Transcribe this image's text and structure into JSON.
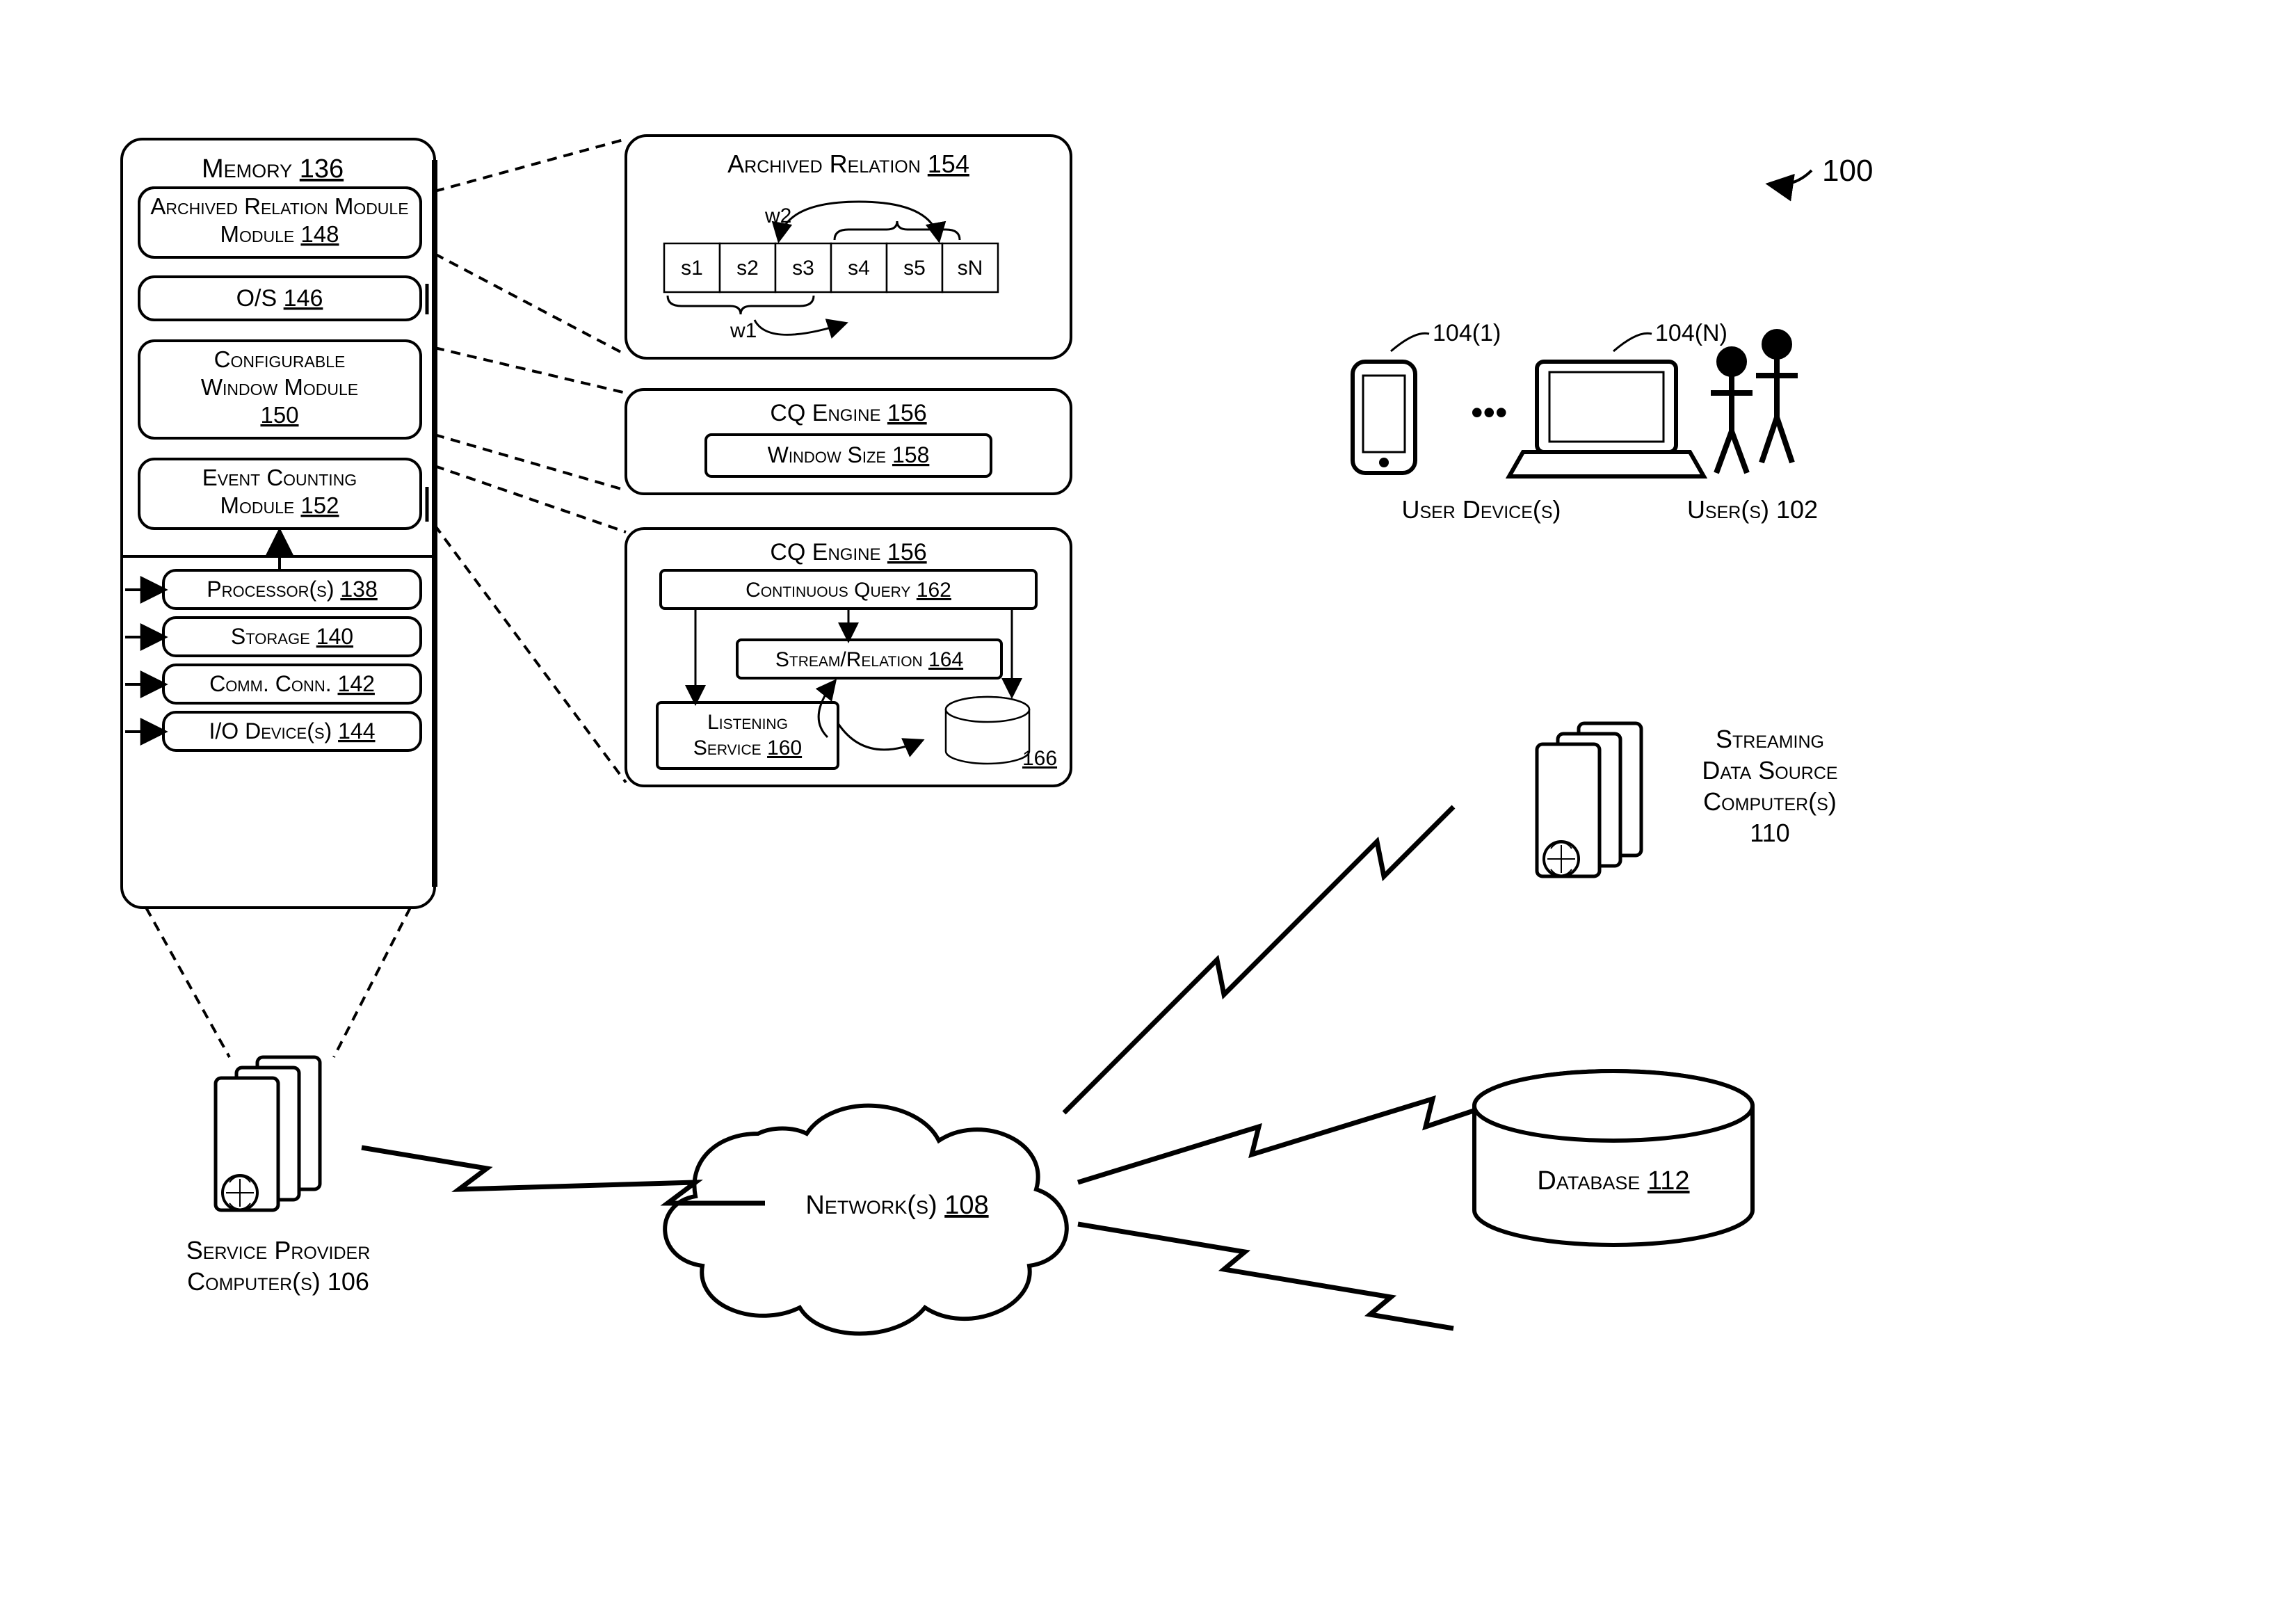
{
  "figure_ref": "100",
  "memory": {
    "title": "Memory",
    "title_ref": "136",
    "archived_relation_module": "Archived Relation Module",
    "archived_relation_module_ref": "148",
    "os": "O/S",
    "os_ref": "146",
    "configurable_window_module_l1": "Configurable",
    "configurable_window_module_l2": "Window Module",
    "configurable_window_module_ref": "150",
    "event_counting_module_l1": "Event Counting",
    "event_counting_module_l2": "Module",
    "event_counting_module_ref": "152",
    "processors": "Processor(s)",
    "processors_ref": "138",
    "storage": "Storage",
    "storage_ref": "140",
    "comm": "Comm. Conn.",
    "comm_ref": "142",
    "io": "I/O Device(s)",
    "io_ref": "144"
  },
  "archived_relation_box": {
    "title": "Archived Relation",
    "title_ref": "154",
    "w1": "w1",
    "w2": "w2",
    "cells": {
      "s1": "s1",
      "s2": "s2",
      "s3": "s3",
      "s4": "s4",
      "s5": "s5",
      "sN": "sN"
    }
  },
  "cq_engine_small": {
    "title": "CQ Engine",
    "title_ref": "156",
    "window_size": "Window Size",
    "window_size_ref": "158"
  },
  "cq_engine_big": {
    "title": "CQ Engine",
    "title_ref": "156",
    "continuous_query": "Continuous Query",
    "continuous_query_ref": "162",
    "stream_relation": "Stream/Relation",
    "stream_relation_ref": "164",
    "listening_service_l1": "Listening",
    "listening_service_l2": "Service",
    "listening_service_ref": "160",
    "db_ref": "166"
  },
  "network": {
    "label": "Network(s)",
    "ref": "108"
  },
  "service_provider": {
    "l1": "Service Provider",
    "l2": "Computer(s) 106"
  },
  "user_devices": {
    "label": "User Device(s)",
    "ref1": "104(1)",
    "refN": "104(N)",
    "dots": "•••"
  },
  "users": {
    "label": "User(s) 102"
  },
  "streaming": {
    "l1": "Streaming",
    "l2": "Data Source",
    "l3": "Computer(s)",
    "l4": "110"
  },
  "database": {
    "label": "Database",
    "ref": "112"
  }
}
